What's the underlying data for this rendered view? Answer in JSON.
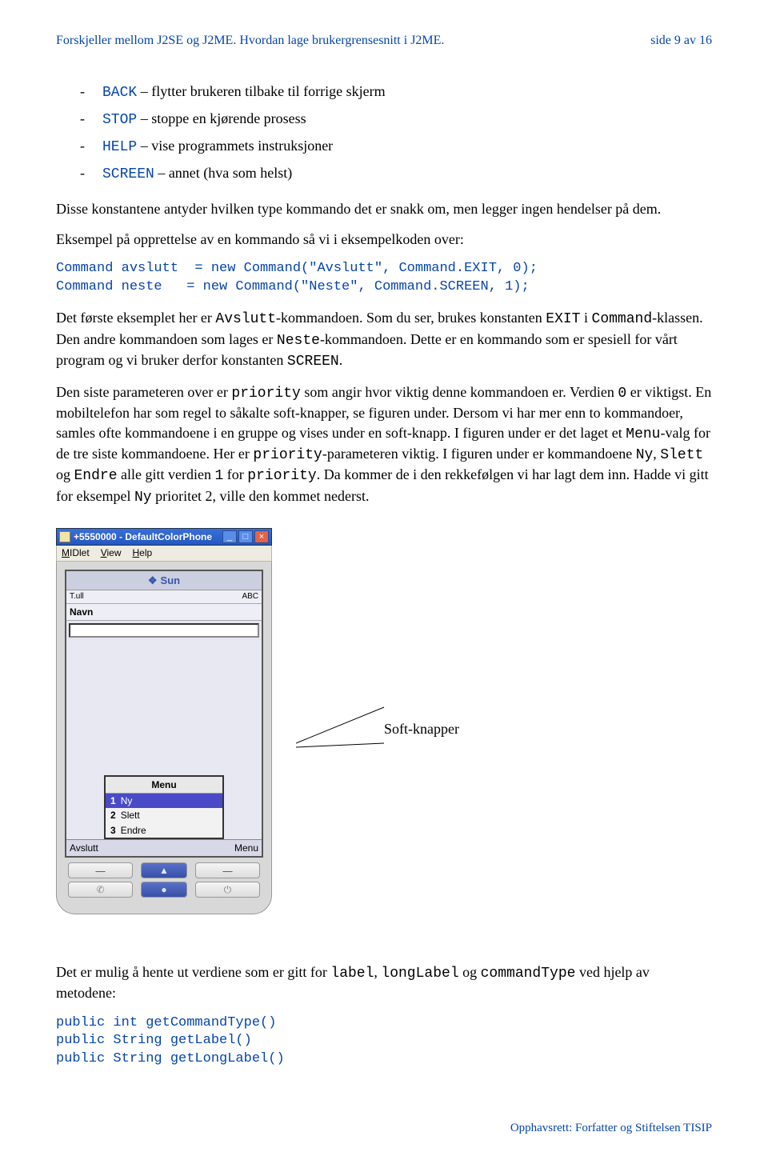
{
  "header": {
    "left": "Forskjeller mellom J2SE og J2ME. Hvordan lage brukergrensesnitt i J2ME.",
    "right": "side 9 av 16"
  },
  "bullets": [
    {
      "code": "BACK",
      "text": " – flytter brukeren tilbake til forrige skjerm"
    },
    {
      "code": "STOP",
      "text": " – stoppe en kjørende prosess"
    },
    {
      "code": "HELP",
      "text": " – vise programmets instruksjoner"
    },
    {
      "code": "SCREEN",
      "text": " – annet (hva som helst)"
    }
  ],
  "p1": "Disse konstantene antyder hvilken type kommando det er snakk om, men legger ingen hendelser på dem.",
  "p2": "Eksempel på opprettelse av en kommando så vi i eksempelkoden over:",
  "code1": "Command avslutt  = new Command(\"Avslutt\", Command.EXIT, 0);\nCommand neste   = new Command(\"Neste\", Command.SCREEN, 1);",
  "p3": {
    "pre": "Det første eksemplet her er ",
    "c1": "Avslutt",
    "t1": "-kommandoen. Som du ser, brukes konstanten ",
    "c2": "EXIT",
    "t2": "  i ",
    "c3": "Command",
    "t3": "-klassen. Den andre kommandoen som lages er ",
    "c4": "Neste",
    "t4": "-kommandoen. Dette er en kommando som er spesiell for vårt program og vi bruker derfor konstanten ",
    "c5": "SCREEN",
    "t5": "."
  },
  "p4": {
    "t0": "Den siste parameteren over er ",
    "c0": "priority",
    "t1": " som angir hvor viktig denne kommandoen er. Verdien ",
    "c1": "0",
    "t2": " er viktigst. En mobiltelefon har som regel to såkalte soft-knapper, se figuren under. Dersom vi har mer enn to kommandoer, samles ofte kommandoene i en gruppe og vises under en soft-knapp. I figuren under er det laget et ",
    "c2": "Menu",
    "t3": "-valg for de tre siste kommandoene. Her er ",
    "c3": "priority",
    "t4": "-parameteren viktig. I figuren under er kommandoene ",
    "c4": "Ny",
    "t5": ", ",
    "c5": "Slett",
    "t6": " og ",
    "c6": "Endre",
    "t7": " alle gitt verdien ",
    "c7": "1",
    "t8": " for ",
    "c8": "priority",
    "t9": ".  Da kommer de i den rekkefølgen vi har lagt dem inn. Hadde vi gitt for eksempel ",
    "c9": "Ny",
    "t10": " prioritet 2, ville den kommet nederst."
  },
  "emulator": {
    "window_title": "+5550000 - DefaultColorPhone",
    "menubar": [
      "MIDlet",
      "View",
      "Help"
    ],
    "brand": "Sun",
    "status_left": "T.ull",
    "status_right": "ABC",
    "navn_label": "Navn",
    "menu_title": "Menu",
    "menu_items": [
      {
        "n": "1",
        "label": "Ny",
        "selected": true
      },
      {
        "n": "2",
        "label": "Slett",
        "selected": false
      },
      {
        "n": "3",
        "label": "Endre",
        "selected": false
      }
    ],
    "soft_left": "Avslutt",
    "soft_right": "Menu",
    "caption": "Soft-knapper"
  },
  "p5": {
    "t0": "Det er mulig å hente ut verdiene som er gitt for ",
    "c0": "label",
    "t1": ", ",
    "c1": "longLabel",
    "t2": " og ",
    "c2": "commandType",
    "t3": " ved hjelp av metodene:"
  },
  "code2": "public int getCommandType()\npublic String getLabel()\npublic String getLongLabel()",
  "footer": "Opphavsrett:  Forfatter og Stiftelsen TISIP"
}
